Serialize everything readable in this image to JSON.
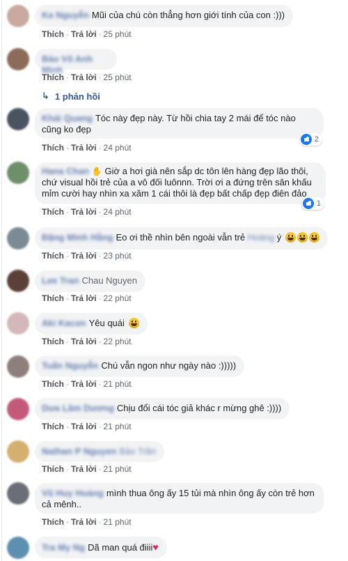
{
  "actions": {
    "like": "Thích",
    "reply": "Trả lời"
  },
  "reply_thread": {
    "label": "1 phản hồi"
  },
  "comments": [
    {
      "name": "Ka Nguyễn",
      "text": "Mũi của chú còn thẳng hơn giới tính của con :)))",
      "time": "25 phút",
      "avatar_color": "#c9a9a0"
    },
    {
      "name": "Bảo Võ Anh Minh",
      "text": "",
      "time": "25 phút",
      "avatar_color": "#8c6b5a"
    },
    {
      "name": "Khải Quang",
      "text_line1": "Tóc này đẹp này. Từ hồi chia tay 2 mái để tóc nào",
      "text_line2": "cũng ko đẹp",
      "time": "24 phút",
      "reaction_count": "2",
      "avatar_color": "#4a5360"
    },
    {
      "name": "Hana Chan",
      "text_line1": "Giờ a hơi già nên sắp dc tôn lên hàng đẹp lão thôi,",
      "text_line2": "chứ visual hồi trẻ của a vô đối luônnn. Trời ơi a đứng trên sân khấu",
      "text_line3": "mỉm cười hay nhìn xa xăm 1 cái thôi là đẹp bất chấp đẹp điên đảo",
      "time": "24 phút",
      "reaction_count": "1",
      "avatar_color": "#6e8f6a"
    },
    {
      "name": "Đặng Minh Hằng",
      "text": "Eo ơi thề nhìn bên ngoài vẫn trẻ",
      "tag": "Hoàng",
      "text_end": "ý",
      "time": "23 phút",
      "avatar_color": "#7b8a94"
    },
    {
      "name": "Lee Tran",
      "mention": "Chau Nguyen",
      "time": "22 phút",
      "avatar_color": "#5a4038"
    },
    {
      "name": "Aki Kacon",
      "text": "Yêu quái",
      "time": "22 phút",
      "avatar_color": "#d4b8b8"
    },
    {
      "name": "Tuấn Nguyễn",
      "text": "Chú vẫn ngon như ngày nào :)))))",
      "time": "21 phút",
      "avatar_color": "#8f7f7a"
    },
    {
      "name": "Dưa Lâm Dương",
      "text": "Chịu đổi cái tóc giả khác r mừng ghê :))))",
      "time": "21 phút",
      "avatar_color": "#c45a7a"
    },
    {
      "name": "Nathan P Nguyen",
      "tag": "Bảo Trần",
      "time": "21 phút",
      "avatar_color": "#d2b070"
    },
    {
      "name": "Vũ Huy Hoàng",
      "text_line1": "mình thua ông ấy 15 tủi mà nhìn ông ấy còn trẻ hơn",
      "text_line2": "cả mênh..",
      "time": "21 phút",
      "avatar_color": "#6a6e78"
    },
    {
      "name": "Tra My Ng",
      "text": "Dã man quá điiii",
      "avatar_color": "#5d8fb0"
    }
  ]
}
